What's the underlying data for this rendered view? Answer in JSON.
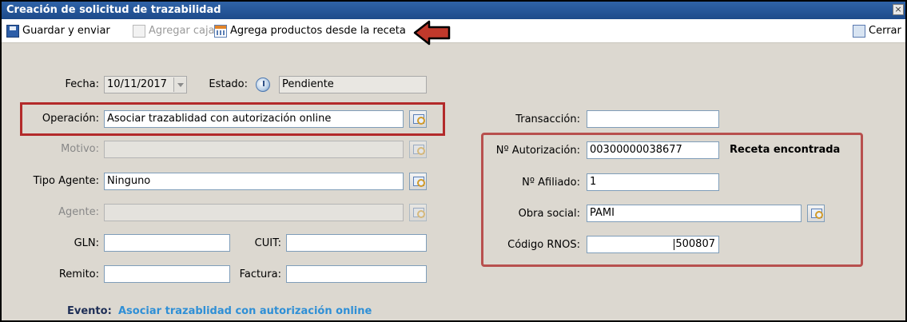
{
  "window": {
    "title": "Creación de solicitud de trazabilidad",
    "close_glyph": "×"
  },
  "toolbar": {
    "save_send": "Guardar y enviar",
    "add_box": "Agregar caja",
    "add_from_recipe": "Agrega productos desde la receta",
    "close": "Cerrar"
  },
  "form": {
    "fecha": {
      "label": "Fecha:",
      "value": "10/11/2017"
    },
    "estado": {
      "label": "Estado:",
      "value": "Pendiente"
    },
    "operacion": {
      "label": "Operación:",
      "value": "Asociar trazablidad con autorización online"
    },
    "motivo": {
      "label": "Motivo:",
      "value": ""
    },
    "tipo_agente": {
      "label": "Tipo Agente:",
      "value": "Ninguno"
    },
    "agente": {
      "label": "Agente:",
      "value": ""
    },
    "gln": {
      "label": "GLN:",
      "value": ""
    },
    "cuit": {
      "label": "CUIT:",
      "value": ""
    },
    "remito": {
      "label": "Remito:",
      "value": ""
    },
    "factura": {
      "label": "Factura:",
      "value": ""
    },
    "transaccion": {
      "label": "Transacción:",
      "value": ""
    },
    "nro_autorizacion": {
      "label": "Nº Autorización:",
      "value": "00300000038677",
      "status": "Receta encontrada"
    },
    "nro_afiliado": {
      "label": "Nº Afiliado:",
      "value": "1"
    },
    "obra_social": {
      "label": "Obra social:",
      "value": "PAMI"
    },
    "codigo_rnos": {
      "label": "Código RNOS:",
      "value": "500807"
    }
  },
  "evento": {
    "label": "Evento:",
    "value": "Asociar trazablidad con autorización online"
  },
  "colors": {
    "title_bar": "#2f63a8",
    "highlight": "#b32a2a",
    "evento_link": "#2f8fd6",
    "panel_bg": "#dcd8d0"
  }
}
